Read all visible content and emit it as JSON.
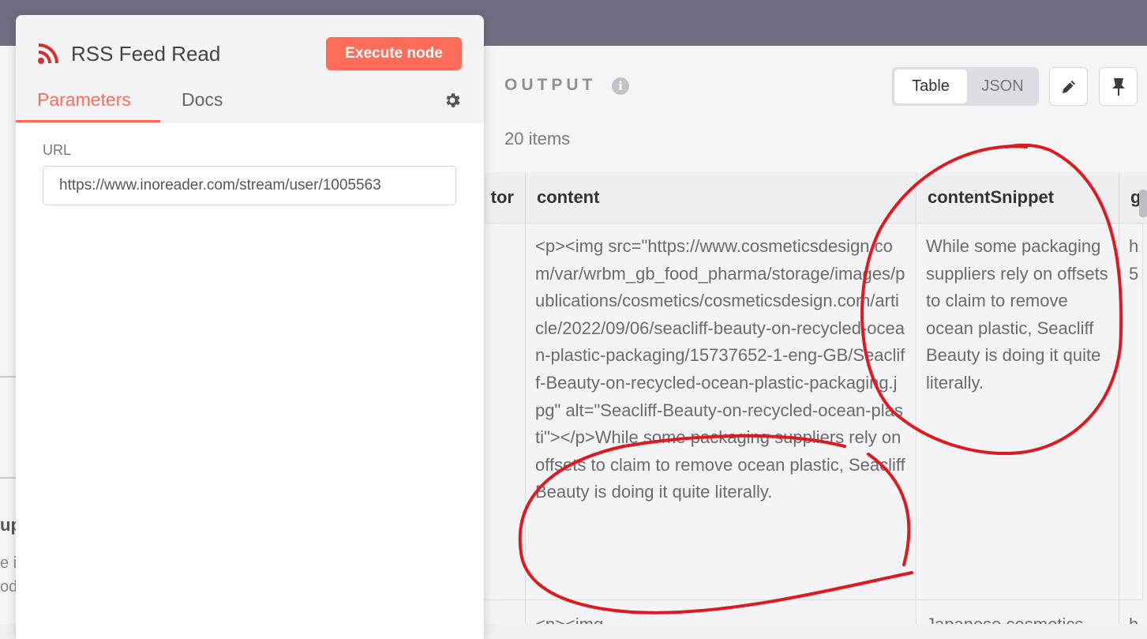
{
  "node": {
    "title": "RSS Feed Read",
    "execute_label": "Execute node",
    "tabs": [
      {
        "label": "Parameters",
        "active": true
      },
      {
        "label": "Docs",
        "active": false
      }
    ],
    "url_label": "URL",
    "url_value": "https://www.inoreader.com/stream/user/1005563"
  },
  "output": {
    "title": "OUTPUT",
    "view_options": [
      "Table",
      "JSON"
    ],
    "active_view": "Table",
    "items_count": "20 items",
    "columns": [
      "tor",
      "content",
      "contentSnippet",
      "g"
    ],
    "rows": [
      {
        "content": "<p><img src=\"https://www.cosmeticsdesign.com/var/wrbm_gb_food_pharma/storage/images/publications/cosmetics/cosmeticsdesign.com/article/2022/09/06/seacliff-beauty-on-recycled-ocean-plastic-packaging/15737652-1-eng-GB/Seacliff-Beauty-on-recycled-ocean-plastic-packaging.jpg\" alt=\"Seacliff-Beauty-on-recycled-ocean-plasti\"></p>While some packaging suppliers rely on offsets to claim to remove ocean plastic, Seacliff Beauty is doing it quite literally.",
        "contentSnippet": "While some packaging suppliers rely on offsets to claim to remove ocean plastic, Seacliff Beauty is doing it quite literally.",
        "g_partial": "h 5"
      },
      {
        "content": "<p><img",
        "contentSnippet": "Japanese cosmetics",
        "g_partial": "h"
      }
    ]
  },
  "background": {
    "heading_partial": "up",
    "text_partial_1": "e i",
    "text_partial_2": "od"
  },
  "colors": {
    "accent": "#ff6d5a",
    "topbar": "#6f6e81",
    "annotation": "#e0191e"
  },
  "icons": [
    "rss-icon",
    "gear-icon",
    "info-icon",
    "pencil-icon",
    "pin-icon"
  ]
}
